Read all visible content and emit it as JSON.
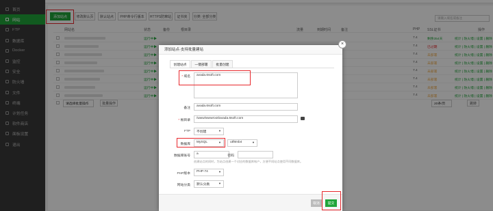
{
  "sidebar": {
    "items": [
      {
        "label": "首页"
      },
      {
        "label": "网站"
      },
      {
        "label": "FTP"
      },
      {
        "label": "数据库"
      },
      {
        "label": "Docker"
      },
      {
        "label": "监控"
      },
      {
        "label": "安全"
      },
      {
        "label": "防火墙"
      },
      {
        "label": "文件"
      },
      {
        "label": "终端"
      },
      {
        "label": "计划任务"
      },
      {
        "label": "软件商店"
      },
      {
        "label": "面板设置"
      },
      {
        "label": "退出"
      }
    ]
  },
  "toolbar": {
    "add_site": "添加站点",
    "default_page": "修改默认页",
    "default_site": "默认站点",
    "php_cli": "PHP命令行版本",
    "https_port": "HTTPS防窜站",
    "ssl_cert": "证书夹",
    "category": "分类: 全部分类",
    "search_placeholder": "请输入域名或备注"
  },
  "table": {
    "headers": [
      "网站名",
      "状态",
      "备份",
      "根目录",
      "流量",
      "到期时间",
      "备注",
      "PHP",
      "SSL证书",
      "操作"
    ],
    "rows": [
      {
        "status": "运行中▶",
        "php": "7.4",
        "ssl": "剩余354天",
        "ops": "统计 | 防火墙 | 设置 | 删除"
      },
      {
        "status": "运行中▶",
        "php": "7.4",
        "ssl": "已过期",
        "ops": "统计 | 防火墙 | 设置 | 删除"
      },
      {
        "status": "运行中▶",
        "php": "7.4",
        "ssl": "未部署",
        "ops": "统计 | 防火墙 | 设置 | 删除"
      },
      {
        "status": "运行中▶",
        "php": "7.4",
        "ssl": "未部署",
        "ops": "统计 | 防火墙 | 设置 | 删除"
      },
      {
        "status": "运行中▶",
        "php": "7.4",
        "ssl": "未部署",
        "ops": "统计 | 防火墙 | 设置 | 删除"
      },
      {
        "status": "运行中▶",
        "php": "7.4",
        "ssl": "未部署",
        "ops": "统计 | 防火墙 | 设置 | 删除"
      },
      {
        "status": "运行中▶",
        "php": "7.4",
        "ssl": "未部署",
        "ops": "统计 | 防火墙 | 设置 | 删除"
      },
      {
        "status": "运行中▶",
        "php": "7.4",
        "ssl": "未部署",
        "ops": "统计 | 防火墙 | 设置 | 删除"
      }
    ],
    "batch": "请选择批量操作",
    "batch_btn": "批量操作",
    "per_page": "20条/页",
    "jump": "跳转"
  },
  "modal": {
    "title": "添加站点-支持批量建站",
    "close": "×",
    "tabs": [
      "创建站点",
      "一键部署",
      "批量创建"
    ],
    "domain_label": "域名",
    "domain_value": "avada.6soft.com",
    "remark_label": "备注",
    "remark_value": "avada.6soft.com",
    "root_label": "根目录",
    "root_value": "/www/wwwroot/avada.6soft.com",
    "ftp_label": "FTP",
    "ftp_value": "不创建",
    "db_label": "数据库",
    "db_value": "MySQL",
    "charset_value": "utf8mb4",
    "dbuser_label": "数据库账号",
    "dbuser_value": "a",
    "dbpass_label": "密码",
    "hint": "创建站点的同时，为站点创建一个对应的数据库帐户，方便不同站点使用不同数据库。",
    "php_label": "PHP版本",
    "php_value": "PHP-74",
    "category_label": "网站分类",
    "category_value": "默认分类",
    "cancel": "取消",
    "submit": "提交"
  },
  "colors": {
    "accent": "#20a53a",
    "highlight": "#e8262b",
    "sidebar": "#3a3a3a"
  }
}
